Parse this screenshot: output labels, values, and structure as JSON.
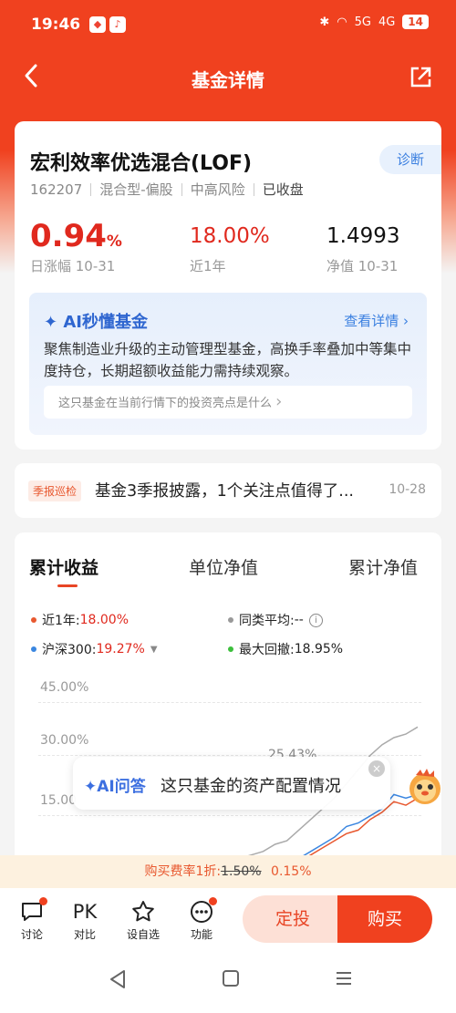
{
  "status_bar": {
    "time": "19:46",
    "battery": "14",
    "signal1": "5G",
    "signal2": "4G"
  },
  "header": {
    "title": "基金详情"
  },
  "fund": {
    "name": "宏利效率优选混合(LOF)",
    "diagnose_label": "诊断",
    "code": "162207",
    "type": "混合型-偏股",
    "risk": "中高风险",
    "status": "已收盘",
    "daily_change": "0.94",
    "daily_change_unit": "%",
    "daily_change_label": "日涨幅 10-31",
    "year_return": "18.00%",
    "year_return_label": "近1年",
    "nav": "1.4993",
    "nav_label": "净值 10-31"
  },
  "ai_summary": {
    "title": "AI秒懂基金",
    "detail_link": "查看详情",
    "text": "聚焦制造业升级的主动管理型基金，高换手率叠加中等集中度持仓，长期超额收益能力需持续观察。",
    "question": "这只基金在当前行情下的投资亮点是什么"
  },
  "news": {
    "tag": "季报巡检",
    "text": "基金3季报披露，1个关注点值得了...",
    "date": "10-28"
  },
  "chart": {
    "tabs": [
      "累计收益",
      "单位净值",
      "累计净值"
    ],
    "active_tab": 0,
    "legend": [
      {
        "label": "近1年:",
        "value": "18.00%",
        "color": "#e8582f",
        "value_red": true
      },
      {
        "label": "同类平均:",
        "value": "--",
        "color": "#999999",
        "value_red": false
      },
      {
        "label": "沪深300:",
        "value": "19.27%",
        "color": "#3a86e0",
        "value_red": true
      },
      {
        "label": "最大回撤:",
        "value": "18.95%",
        "color": "#3cbf3c",
        "value_red": false
      }
    ],
    "overlay_label": "25.43%"
  },
  "chart_data": {
    "type": "line",
    "yticks": [
      "45.00%",
      "30.00%",
      "15.00"
    ],
    "ylim": [
      -15,
      45
    ],
    "series": [
      {
        "name": "近1年",
        "color": "#e8582f",
        "values": [
          -10,
          -9,
          -11,
          -8,
          -10,
          -12,
          -9,
          -11,
          -10,
          -8,
          -9,
          -7,
          -6,
          -5,
          -6,
          -3,
          -1,
          0,
          2,
          4,
          6,
          8,
          9,
          12,
          14,
          17,
          16,
          18
        ]
      },
      {
        "name": "沪深300",
        "color": "#3a86e0",
        "values": [
          -9,
          -10,
          -12,
          -9,
          -11,
          -13,
          -10,
          -12,
          -11,
          -9,
          -10,
          -8,
          -7,
          -6,
          -5,
          -2,
          0,
          1,
          3,
          5,
          7,
          10,
          11,
          13,
          15,
          19,
          18,
          19
        ]
      },
      {
        "name": "最大回撤",
        "color": "#3cbf3c",
        "values": [
          -2,
          -6,
          -3,
          -7,
          -4,
          -5,
          -2,
          -6,
          -3,
          -5,
          -7,
          -4,
          -6,
          -3,
          -5,
          -8,
          -6,
          -9,
          -7,
          -10,
          -8,
          -11,
          -9,
          -12,
          -10,
          -13,
          -11,
          -12
        ]
      },
      {
        "name": "同类平均",
        "color": "#aaaaaa",
        "values": [
          -5,
          -5,
          -6,
          -6,
          -4,
          -3,
          -5,
          -4,
          -3,
          -2,
          -1,
          0,
          1,
          2,
          3,
          5,
          6,
          9,
          12,
          15,
          18,
          22,
          26,
          30,
          33,
          35,
          36,
          38
        ]
      }
    ]
  },
  "ai_float": {
    "lead": "AI问答",
    "question": "这只基金的资产配置情况"
  },
  "fee": {
    "prefix": "购买费率1折:",
    "old": "1.50%",
    "new": "0.15%"
  },
  "bottom": {
    "tools": [
      {
        "label": "讨论",
        "icon": "chat-icon",
        "badge": true
      },
      {
        "label": "对比",
        "icon": "pk-icon",
        "badge": false
      },
      {
        "label": "设自选",
        "icon": "star-icon",
        "badge": false
      },
      {
        "label": "功能",
        "icon": "more-icon",
        "badge": true
      }
    ],
    "pk_text": "PK",
    "dingtou": "定投",
    "buy": "购买"
  }
}
